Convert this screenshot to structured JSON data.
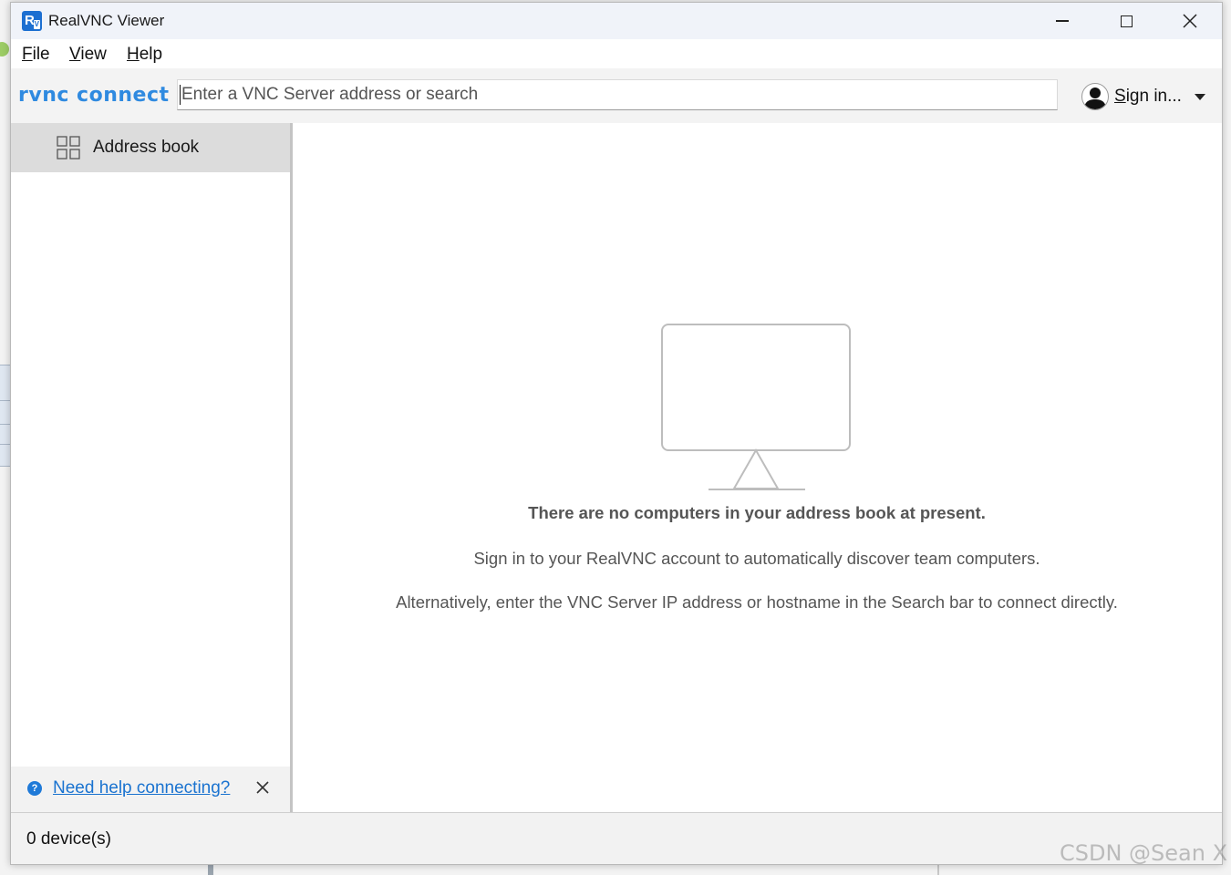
{
  "window": {
    "title": "RealVNC Viewer",
    "controls": {
      "minimize": "minimize-icon",
      "maximize": "maximize-icon",
      "close": "close-icon"
    }
  },
  "menu": {
    "items": [
      {
        "first": "F",
        "rest": "ile"
      },
      {
        "first": "V",
        "rest": "iew"
      },
      {
        "first": "H",
        "rest": "elp"
      }
    ]
  },
  "toolbar": {
    "brand": "RVNC CONNECT",
    "search": {
      "placeholder": "Enter a VNC Server address or search",
      "value": ""
    },
    "signin": {
      "first": "S",
      "rest": "ign in..."
    }
  },
  "sidebar": {
    "items": [
      {
        "label": "Address book",
        "icon": "grid-icon",
        "selected": true
      }
    ],
    "help_link": "Need help connecting?"
  },
  "main": {
    "empty_title": "There are no computers in your address book at present.",
    "empty_line1": "Sign in to your RealVNC account to automatically discover team computers.",
    "empty_line2": "Alternatively, enter the VNC Server IP address or hostname in the Search bar to connect directly."
  },
  "status": {
    "device_count": "0 device(s)"
  },
  "watermark": "CSDN @Sean X",
  "colors": {
    "accent": "#1a73d0",
    "brand": "#2f8ae0",
    "selected_nav": "#dcdcdc",
    "text_muted": "#555555"
  }
}
